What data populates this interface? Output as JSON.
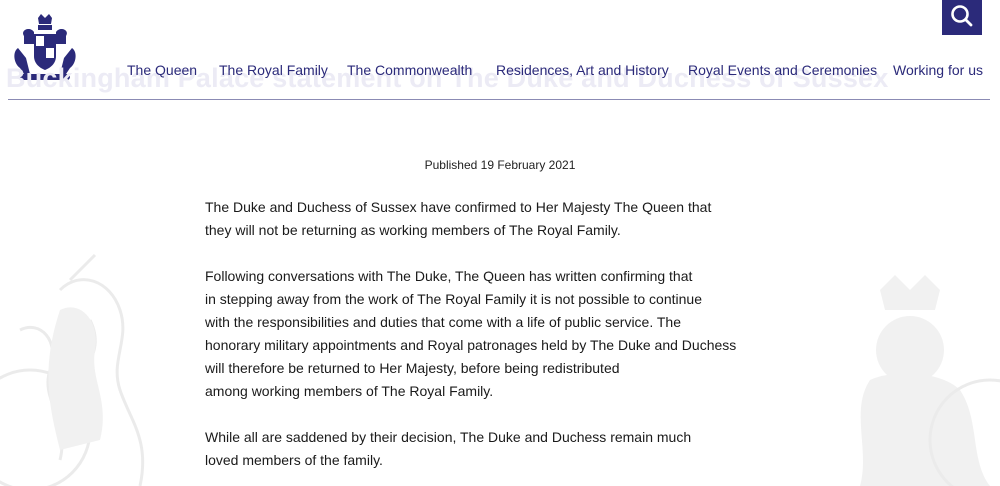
{
  "site": {
    "logo_icon": "royal-coat-of-arms-icon",
    "search_icon": "search-icon",
    "brand_color": "#2b2a7a"
  },
  "page_title": "Buckingham Palace statement on The Duke and Duchess of Sussex",
  "nav": {
    "items": [
      {
        "label": "The Queen"
      },
      {
        "label": "The Royal Family"
      },
      {
        "label": "The Commonwealth"
      },
      {
        "label": "Residences, Art and History"
      },
      {
        "label": "Royal Events and Ceremonies"
      },
      {
        "label": "Working for us"
      }
    ]
  },
  "article": {
    "published": "Published 19 February 2021",
    "paragraphs": [
      {
        "lines": [
          "The Duke and Duchess of Sussex have confirmed to Her Majesty The Queen that",
          "they will not be returning as working members of The Royal Family."
        ]
      },
      {
        "lines": [
          "Following conversations with The Duke, The Queen has written confirming that",
          "in stepping away from the work of The Royal Family it is not possible to continue",
          "with the responsibilities and duties that come with a life of public service. The",
          "honorary military appointments and Royal patronages held by The Duke and Duchess",
          "will therefore be returned to Her Majesty, before being redistributed",
          "among working members of The Royal Family."
        ]
      },
      {
        "lines": [
          "While all are saddened by their decision, The Duke and Duchess remain much",
          "loved members of the family."
        ]
      }
    ]
  }
}
